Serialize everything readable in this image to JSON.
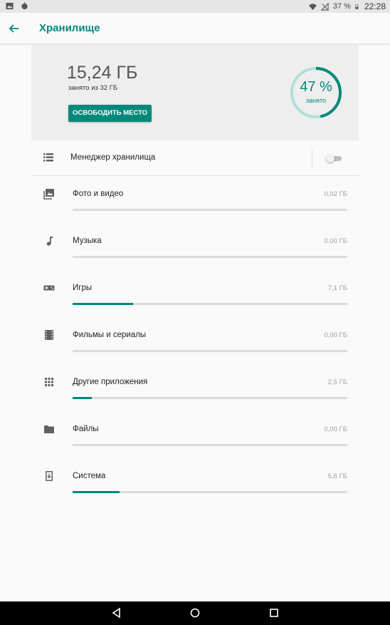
{
  "status_bar": {
    "battery": "37 %",
    "time": "22:28",
    "icons": [
      "image-icon",
      "android-icon",
      "wifi-icon",
      "no-signal-icon",
      "battery-icon"
    ]
  },
  "app_bar": {
    "title": "Хранилище",
    "back_icon": "arrow-back-icon",
    "accent_color": "#00897b"
  },
  "summary": {
    "used": "15,24 ГБ",
    "of_total": "занято из 32 ГБ",
    "free_button": "ОСВОБОДИТЬ МЕСТО",
    "percent": "47 %",
    "percent_label": "занято",
    "percent_value": 0.47
  },
  "storage_manager": {
    "label": "Менеджер хранилища",
    "icon": "list-icon",
    "enabled": false
  },
  "categories": [
    {
      "label": "Фото и видео",
      "size": "0,02 ГБ",
      "icon": "photo-icon",
      "fill": 0.0
    },
    {
      "label": "Музыка",
      "size": "0,00 ГБ",
      "icon": "music-note-icon",
      "fill": 0.0
    },
    {
      "label": "Игры",
      "size": "7,1 ГБ",
      "icon": "gamepad-icon",
      "fill": 0.22
    },
    {
      "label": "Фильмы и сериалы",
      "size": "0,00 ГБ",
      "icon": "movie-icon",
      "fill": 0.0
    },
    {
      "label": "Другие приложения",
      "size": "2,5 ГБ",
      "icon": "apps-grid-icon",
      "fill": 0.07
    },
    {
      "label": "Файлы",
      "size": "0,00 ГБ",
      "icon": "folder-icon",
      "fill": 0.0
    },
    {
      "label": "Система",
      "size": "5,6 ГБ",
      "icon": "system-update-icon",
      "fill": 0.17
    }
  ],
  "nav_bar": {
    "icons": [
      "back-triangle-icon",
      "home-circle-icon",
      "recents-square-icon"
    ]
  }
}
